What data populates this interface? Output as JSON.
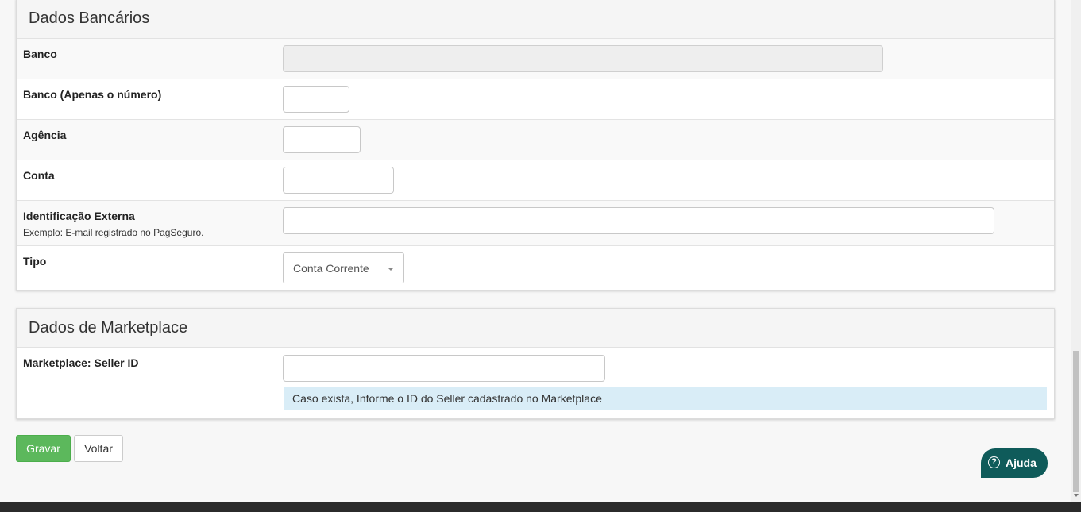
{
  "bank_panel": {
    "title": "Dados Bancários",
    "fields": {
      "banco": {
        "label": "Banco",
        "value": ""
      },
      "banco_numero": {
        "label": "Banco (Apenas o número)",
        "value": ""
      },
      "agencia": {
        "label": "Agência",
        "value": ""
      },
      "conta": {
        "label": "Conta",
        "value": ""
      },
      "id_externa": {
        "label": "Identificação Externa",
        "hint": "Exemplo: E-mail registrado no PagSeguro.",
        "value": ""
      },
      "tipo": {
        "label": "Tipo",
        "selected": "Conta Corrente"
      }
    }
  },
  "marketplace_panel": {
    "title": "Dados de Marketplace",
    "seller": {
      "label": "Marketplace: Seller ID",
      "value": "",
      "info": "Caso exista, Informe o ID do Seller cadastrado no Marketplace"
    }
  },
  "actions": {
    "save_label": "Gravar",
    "back_label": "Voltar"
  },
  "help": {
    "label": "Ajuda",
    "icon": "question-circle-icon",
    "color": "#0f5b5a"
  },
  "colors": {
    "primary_green": "#5cb85c",
    "info_bg": "#d9edf7"
  }
}
